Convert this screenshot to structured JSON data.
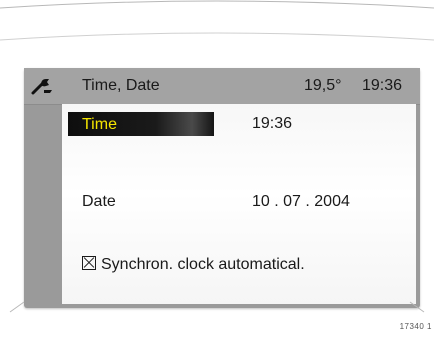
{
  "header": {
    "icon": "wrench-icon",
    "title": "Time, Date",
    "temperature": "19,5°",
    "clock": "19:36"
  },
  "rows": [
    {
      "label": "Time",
      "value": "19:36",
      "selected": true
    },
    {
      "label": "Date",
      "value": "10 . 07 . 2004",
      "selected": false
    }
  ],
  "sync_option": {
    "checked": true,
    "label": "Synchron. clock automatical."
  },
  "reference_number": "17340 1",
  "colors": {
    "display_frame": "#9a9a9a",
    "header_background": "#a3a3a3",
    "selection_background": "#111111",
    "selection_text": "#f5e600",
    "text": "#1a1a1a"
  }
}
